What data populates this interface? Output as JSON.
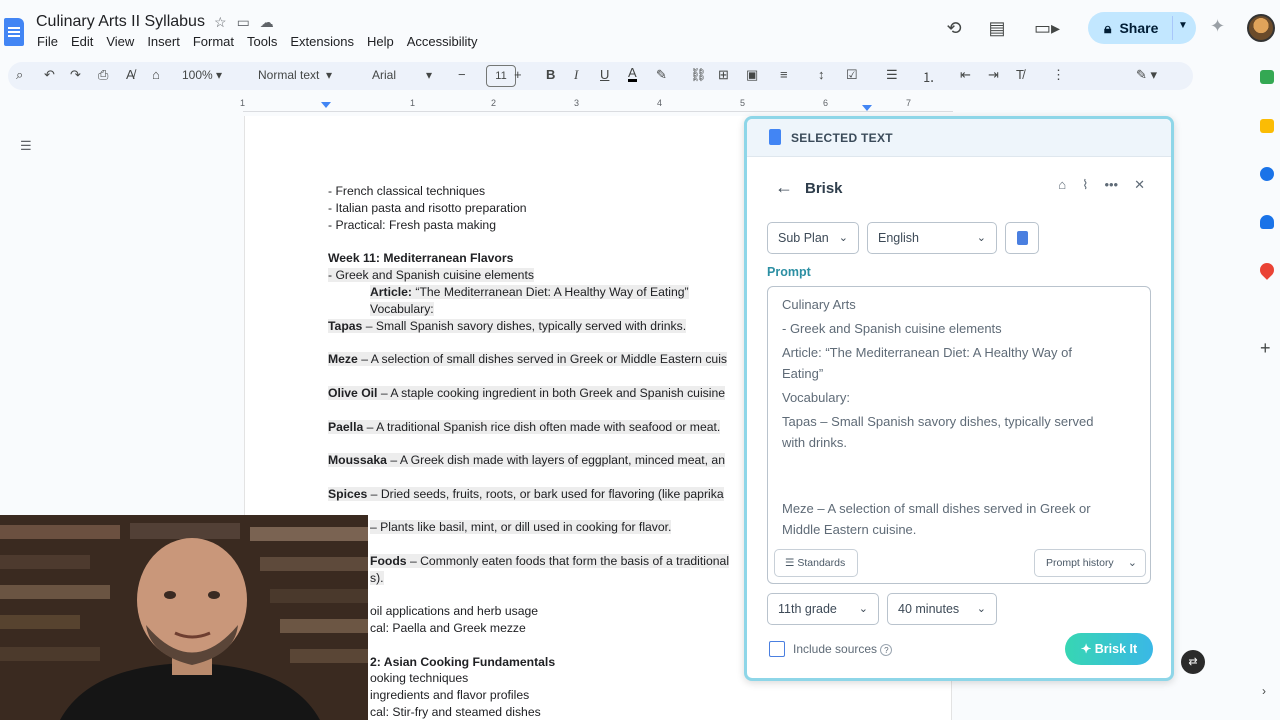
{
  "header": {
    "doc_title": "Culinary Arts II Syllabus",
    "menu": [
      "File",
      "Edit",
      "View",
      "Insert",
      "Format",
      "Tools",
      "Extensions",
      "Help",
      "Accessibility"
    ],
    "share_label": "Share"
  },
  "toolbar": {
    "zoom": "100%",
    "style": "Normal text",
    "font": "Arial",
    "font_size": "11"
  },
  "ruler": {
    "marks": [
      "1",
      "1",
      "2",
      "3",
      "4",
      "5",
      "6",
      "7"
    ]
  },
  "document": {
    "lines": [
      "- French classical techniques",
      "- Italian pasta and risotto preparation",
      "- Practical: Fresh pasta making",
      "Week 11: Mediterranean Flavors",
      "- Greek and Spanish cuisine elements",
      "Article:",
      " “The Mediterranean Diet: A Healthy Way of Eating”",
      "Vocabulary:",
      "Tapas",
      " – Small Spanish savory dishes, typically served with drinks.",
      "Meze",
      " – A selection of small dishes served in Greek or Middle Eastern cuis",
      "Olive Oil",
      " – A staple cooking ingredient in both Greek and Spanish cuisine",
      "Paella",
      " – A traditional Spanish rice dish often made with seafood or meat.",
      "Moussaka",
      " – A Greek dish made with layers of eggplant, minced meat, an",
      "Spices",
      " – Dried seeds, fruits, roots, or bark used for flavoring (like paprika",
      "– Plants like basil, mint, or dill used in cooking for flavor.",
      "Foods",
      " – Commonly eaten foods that form the basis of a traditional",
      "s).",
      "oil applications and herb usage",
      "cal: Paella and Greek mezze",
      "2: Asian Cooking Fundamentals",
      "ooking techniques",
      "ingredients and flavor profiles",
      "cal: Stir-fry and steamed dishes"
    ]
  },
  "brisk": {
    "selected_label": "SELECTED TEXT",
    "title": "Brisk",
    "sub_plan": "Sub Plan",
    "language": "English",
    "prompt_label": "Prompt",
    "prompt_lines": [
      "Culinary Arts",
      "- Greek and Spanish cuisine elements",
      "    Article: “The Mediterranean Diet: A Healthy Way of",
      "Eating”",
      "    Vocabulary:",
      "Tapas – Small Spanish savory dishes, typically served",
      "with drinks.",
      "Meze – A selection of small dishes served in Greek or",
      "Middle Eastern cuisine."
    ],
    "standards": "Standards",
    "prompt_history": "Prompt history",
    "grade": "11th grade",
    "duration": "40 minutes",
    "include_sources": "Include sources",
    "submit": "Brisk It"
  },
  "colors": {
    "accent": "#4285f4",
    "share_bg": "#c2e7ff",
    "brisk_border": "#8ed6e8",
    "prompt_label": "#2c8fa3"
  }
}
